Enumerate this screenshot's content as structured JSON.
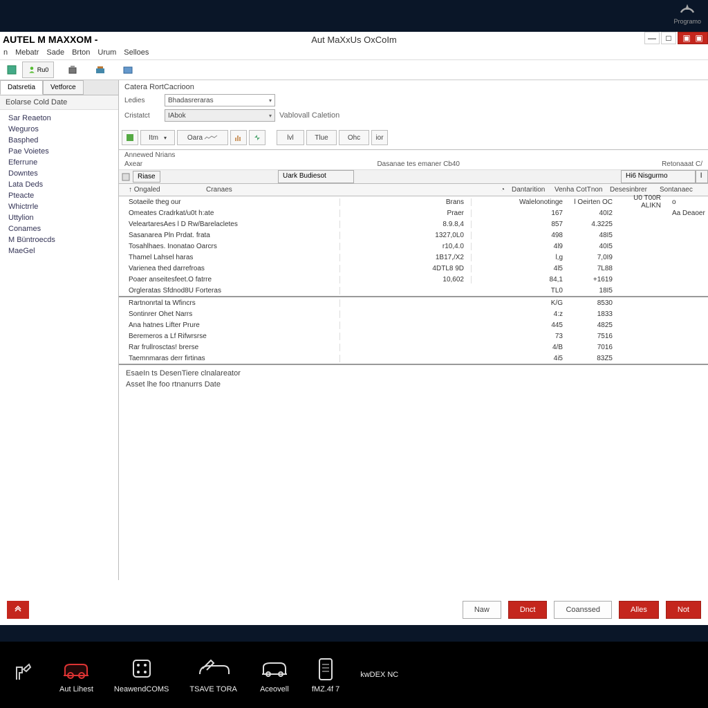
{
  "logo_label": "Programo",
  "titlebar": {
    "left": "AUTEL M MAXXOM -",
    "center": "Aut MaXxUs OxCoIm"
  },
  "menu": [
    "n",
    "Mebatr",
    "Sade",
    "Brton",
    "Urum",
    "Selloes"
  ],
  "side_tabs": [
    "Datsretia",
    "Vetforce"
  ],
  "sidebar_header": "Eolarse Cold Date",
  "sidebar_items": [
    "Sar Reaeton",
    "Weguros",
    "Basphed",
    "Pae Voietes",
    "Eferrune",
    "Downtes",
    "Lata Deds",
    "Pteacte",
    "Whictrrle",
    "Uttylion",
    "Conames",
    "M Büntroecds",
    "MaeGel"
  ],
  "form": {
    "section_title": "Catera RortCacrioon",
    "label_leches": "Ledies",
    "val_leches": "Bhadasreraras",
    "label_cristatt": "Cristatct",
    "val_cristatt": "IAbok",
    "side_label": "Vablovall Caletion"
  },
  "mini_tb": {
    "b1": "Itm",
    "b2": "Oara",
    "b3": "lvl",
    "b4": "Tlue",
    "b5": "Ohc",
    "b6": "ior"
  },
  "tbl_top": {
    "l1": "Annewed Nrians",
    "l2": "Axear",
    "center": "Dasanae tes emaner Cb40",
    "right": "Retonaaat C/",
    "h_riase": "Riase",
    "h_uarbudiesot": "Uark Budiesot",
    "h_hisgarmo": "Hi6 Nisgurmo",
    "sub1": "Ongaled",
    "sub2": "Cranaes",
    "sub3": "Dantarition",
    "sub4": "Venha CotTnon",
    "sub5": "Desesinbrer",
    "sub6": "Sontanaec"
  },
  "rows": [
    {
      "a": "Sotaeile theg our",
      "b": "Brans",
      "c": "",
      "d": "Walelonotinge",
      "e": "l Oeirten OC",
      "f": "U0 T00R ALIKN",
      "g": "o"
    },
    {
      "a": "Omeates Cradrkat/u0t h:ate",
      "b": "Praer",
      "c": "",
      "d": "167",
      "e": "40I2",
      "f": "",
      "g": "Aa Deaoer"
    },
    {
      "a": "VeleartaresAes l D Rw/Barelacletes",
      "b": "8.9.8,4",
      "c": "",
      "d": "857",
      "e": "4.3225",
      "f": "",
      "g": ""
    },
    {
      "a": "Sasanarea Pln Prdat. frata",
      "b": "1327,0L0",
      "c": "",
      "d": "498",
      "e": "48I5",
      "f": "",
      "g": ""
    },
    {
      "a": "Tosahlhaes. Inonatao Oarcrs",
      "b": "r10,4.0",
      "c": "",
      "d": "4l9",
      "e": "40I5",
      "f": "",
      "g": ""
    },
    {
      "a": "Thamel Lahsel haras",
      "b": "1B17,/X2",
      "c": "",
      "d": "l,g",
      "e": "7,0I9",
      "f": "",
      "g": ""
    },
    {
      "a": "Varienea thed darrefroas",
      "b": "4DTL8 9D",
      "c": "",
      "d": "4l5",
      "e": "7L88",
      "f": "",
      "g": ""
    },
    {
      "a": "Poaer anseitesfeet.O fatrre",
      "b": "10,602",
      "c": "",
      "d": "84,1",
      "e": "+1619",
      "f": "",
      "g": ""
    },
    {
      "a": "Orgleratas Sfdnod8U Forteras",
      "b": "",
      "c": "",
      "d": "TL0",
      "e": "18I5",
      "f": "",
      "g": ""
    }
  ],
  "rows2": [
    {
      "a": "Rartnonrtal ta Wfincrs",
      "b": "",
      "d": "K/G",
      "e": "8530"
    },
    {
      "a": "Sontinrer Ohet Narrs",
      "b": "",
      "d": "4:z",
      "e": "1833"
    },
    {
      "a": "Ana hatnes Lifter Prure",
      "b": "",
      "d": "445",
      "e": "4825"
    },
    {
      "a": "Beremeros a Lf Rifwrsrse",
      "b": "",
      "d": "73",
      "e": "7516"
    },
    {
      "a": "Rar frullrosctas! brerse",
      "b": "",
      "d": "4/B",
      "e": "7016"
    },
    {
      "a": "Taemnmaras derr firtinas",
      "b": "",
      "d": "4i5",
      "e": "83Z5"
    }
  ],
  "notes": {
    "l1": "EsaeIn ts DesenTiere clnalareator",
    "l2": "Asset lhe foo rtnanurrs Date"
  },
  "footer": {
    "b1": "Naw",
    "b2": "Dnct",
    "b3": "Coanssed",
    "b4": "Alles",
    "b5": "Not"
  },
  "dock": [
    "Aut Lihest",
    "NeawendCOMS",
    "TSAVE TORA",
    "Aceovell",
    "fMZ.4f 7",
    "kwDEX NC"
  ]
}
